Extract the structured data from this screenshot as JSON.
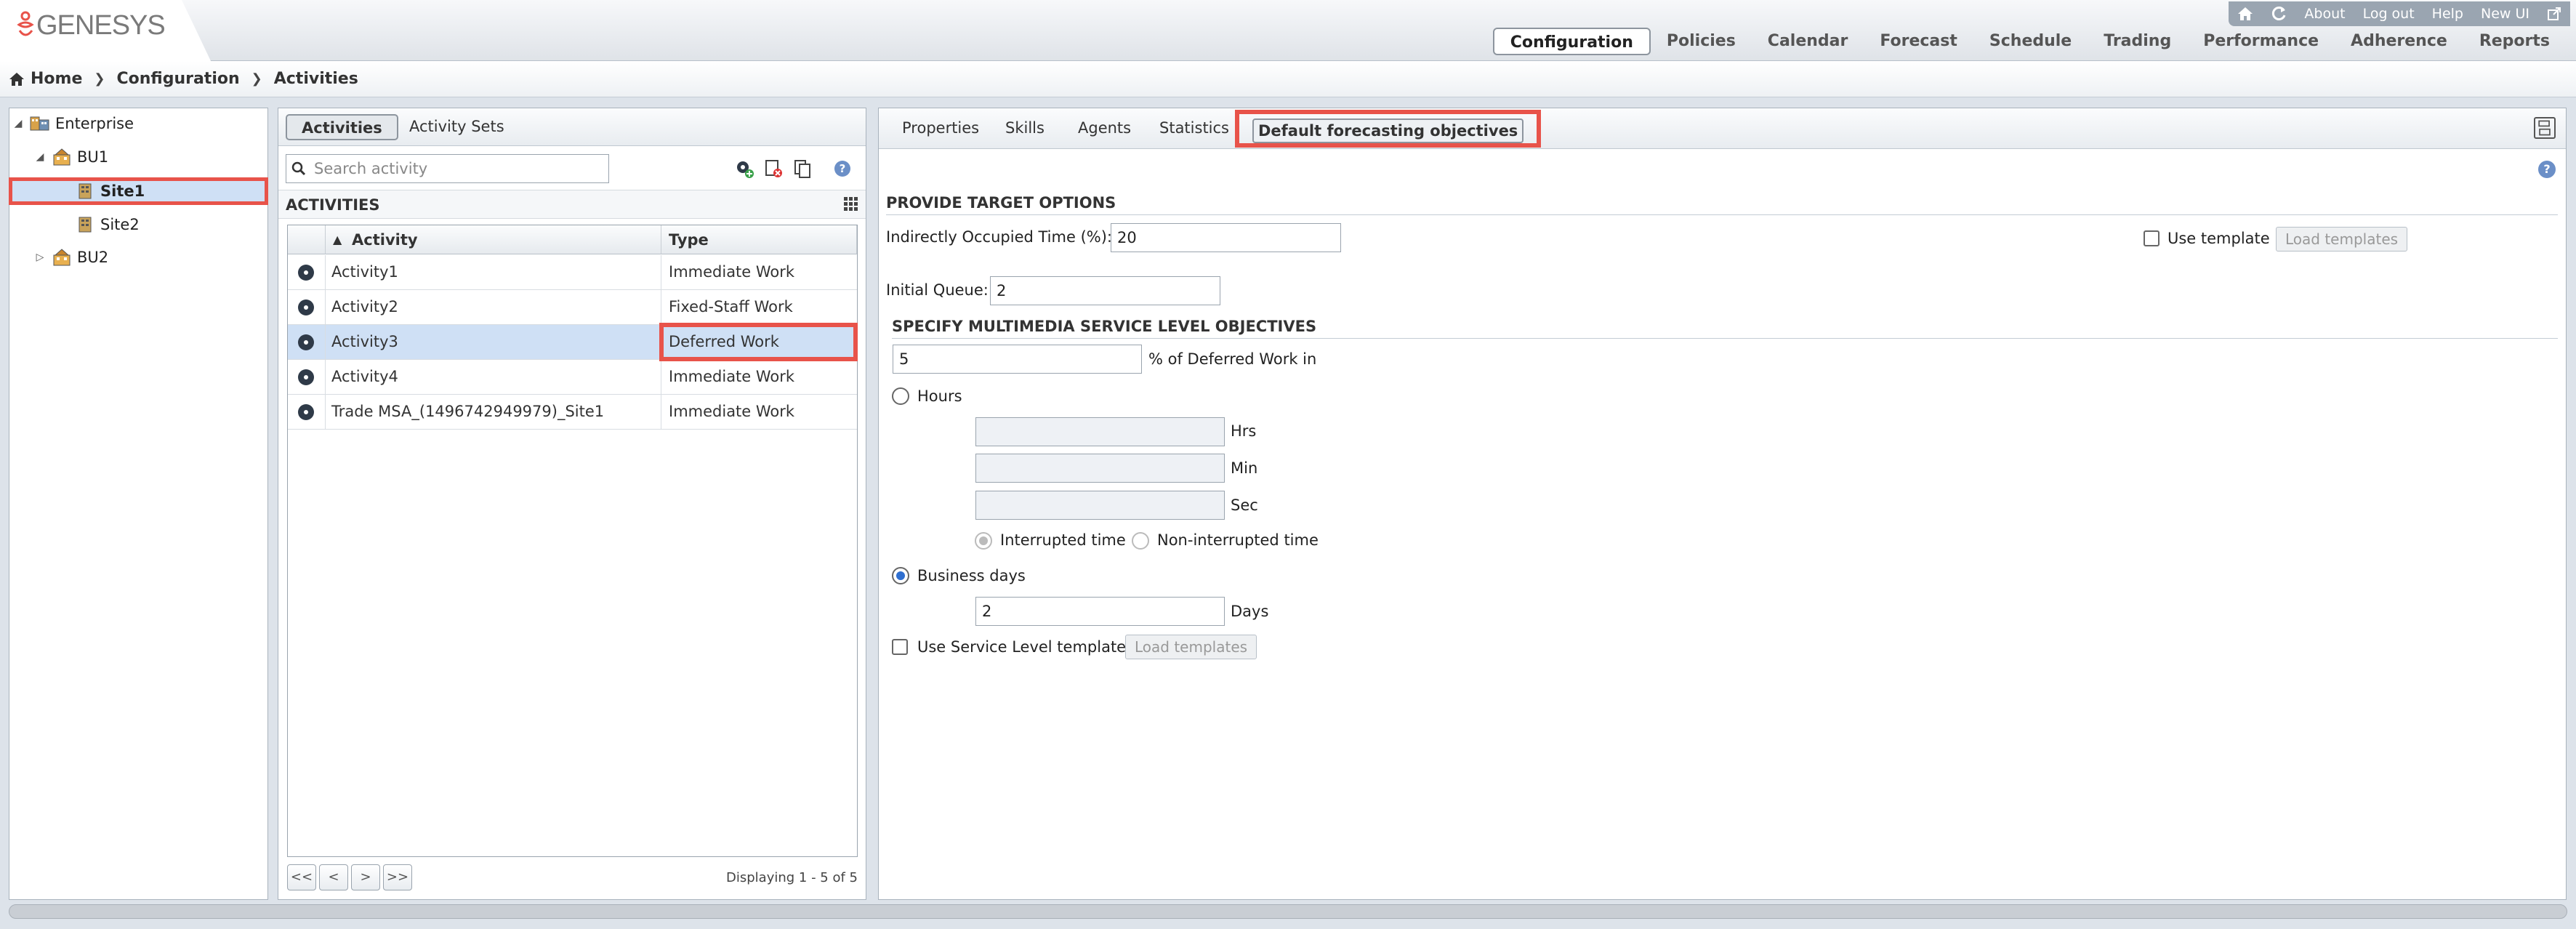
{
  "app": {
    "logo_text": "GENESYS"
  },
  "util_links": [
    "About",
    "Log out",
    "Help",
    "New UI"
  ],
  "main_nav": [
    "Configuration",
    "Policies",
    "Calendar",
    "Forecast",
    "Schedule",
    "Trading",
    "Performance",
    "Adherence",
    "Reports"
  ],
  "breadcrumb": [
    "Home",
    "Configuration",
    "Activities"
  ],
  "tree": {
    "enterprise": "Enterprise",
    "bu1": "BU1",
    "site1": "Site1",
    "site2": "Site2",
    "bu2": "BU2"
  },
  "activities_panel": {
    "tabs": [
      "Activities",
      "Activity Sets"
    ],
    "search_placeholder": "Search activity",
    "section_title": "ACTIVITIES",
    "columns": [
      "Activity",
      "Type"
    ],
    "rows": [
      {
        "activity": "Activity1",
        "type": "Immediate Work"
      },
      {
        "activity": "Activity2",
        "type": "Fixed-Staff Work"
      },
      {
        "activity": "Activity3",
        "type": "Deferred Work"
      },
      {
        "activity": "Activity4",
        "type": "Immediate Work"
      },
      {
        "activity": "Trade MSA_(1496742949979)_Site1",
        "type": "Immediate Work"
      }
    ],
    "pager": {
      "first": "<<",
      "prev": "<",
      "next": ">",
      "last": ">>"
    },
    "displaying": "Displaying 1 - 5 of 5"
  },
  "right_panel": {
    "tabs": [
      "Properties",
      "Skills",
      "Agents",
      "Statistics",
      "Default forecasting objectives"
    ],
    "target_header": "PROVIDE TARGET OPTIONS",
    "iot_label": "Indirectly Occupied Time (%):",
    "iot_value": "20",
    "initial_queue_label": "Initial Queue:",
    "initial_queue_value": "2",
    "use_template_label": "Use template",
    "load_templates_label": "Load templates",
    "sl_header": "SPECIFY MULTIMEDIA SERVICE LEVEL OBJECTIVES",
    "pct_value": "5",
    "pct_label": "% of Deferred Work in",
    "hours_label": "Hours",
    "hrs_label": "Hrs",
    "min_label": "Min",
    "sec_label": "Sec",
    "interrupted_label": "Interrupted time",
    "noninterrupted_label": "Non-interrupted time",
    "business_days_label": "Business days",
    "days_value": "2",
    "days_label": "Days",
    "use_sl_template_label": "Use Service Level template",
    "load_templates2_label": "Load templates"
  },
  "colors": {
    "highlight": "#e8534a",
    "selected_row": "#cfe0f5",
    "radio_on": "#2f6fd0"
  }
}
